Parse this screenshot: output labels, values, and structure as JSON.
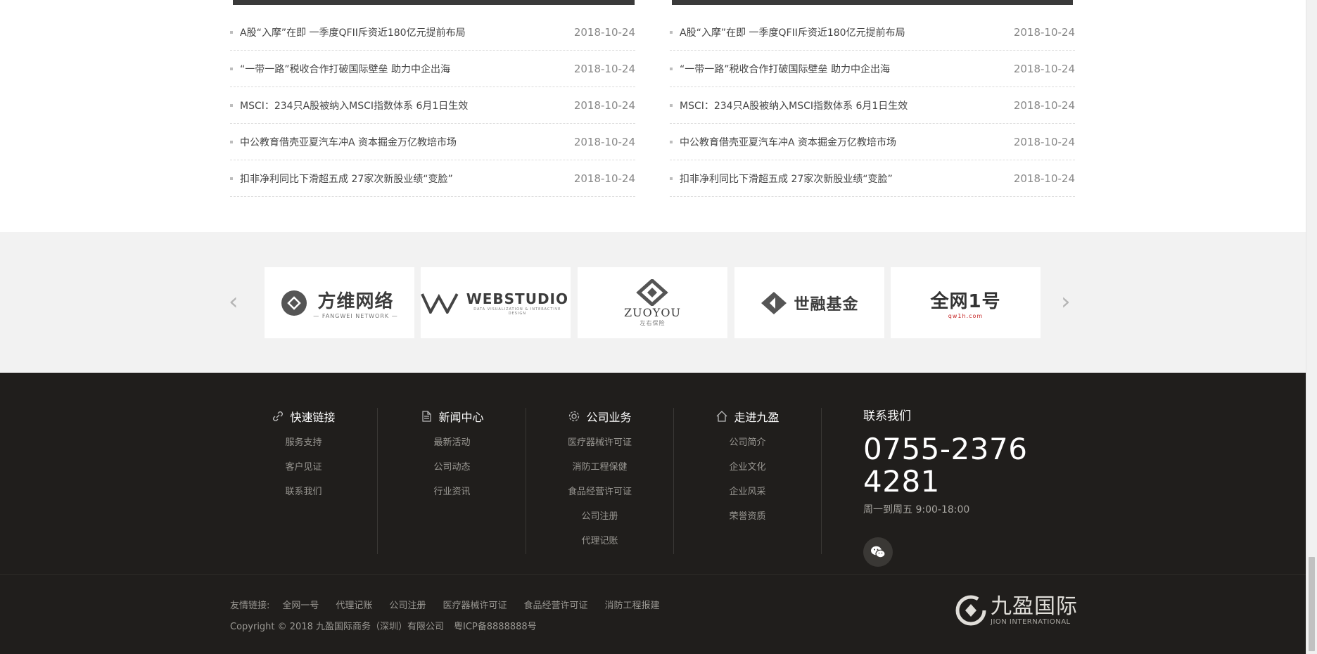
{
  "news": {
    "left_column": [
      {
        "title": "A股“入摩”在即 一季度QFII斥资近180亿元提前布局",
        "date": "2018-10-24"
      },
      {
        "title": "“一带一路”税收合作打破国际壁垒 助力中企出海",
        "date": "2018-10-24"
      },
      {
        "title": "MSCI：234只A股被纳入MSCI指数体系 6月1日生效",
        "date": "2018-10-24"
      },
      {
        "title": "中公教育借壳亚夏汽车冲A 资本掘金万亿教培市场",
        "date": "2018-10-24"
      },
      {
        "title": "扣非净利同比下滑超五成 27家次新股业绩“变脸”",
        "date": "2018-10-24"
      }
    ],
    "right_column": [
      {
        "title": "A股“入摩”在即 一季度QFII斥资近180亿元提前布局",
        "date": "2018-10-24"
      },
      {
        "title": "“一带一路”税收合作打破国际壁垒 助力中企出海",
        "date": "2018-10-24"
      },
      {
        "title": "MSCI：234只A股被纳入MSCI指数体系 6月1日生效",
        "date": "2018-10-24"
      },
      {
        "title": "中公教育借壳亚夏汽车冲A 资本掘金万亿教培市场",
        "date": "2018-10-24"
      },
      {
        "title": "扣非净利同比下滑超五成 27家次新股业绩“变脸”",
        "date": "2018-10-24"
      }
    ]
  },
  "partners": {
    "prev_icon": "chevron-left-icon",
    "next_icon": "chevron-right-icon",
    "prev_glyph": "‹",
    "next_glyph": "›",
    "logos": [
      {
        "name": "方维网络",
        "sub": "— FANGWEI NETWORK —"
      },
      {
        "name": "WEBSTUDIO",
        "sub": "DATA VISUALIZATION & INTERACTIVE DESIGN"
      },
      {
        "name": "ZUOYOU",
        "sub": "左右保险"
      },
      {
        "name": "世融基金",
        "sub": ""
      },
      {
        "name": "全网1号",
        "sub": "qw1h.com"
      }
    ]
  },
  "footer": {
    "columns": [
      {
        "title": "快速链接",
        "icon": "link-icon",
        "links": [
          "服务支持",
          "客户见证",
          "联系我们"
        ]
      },
      {
        "title": "新闻中心",
        "icon": "document-icon",
        "links": [
          "最新活动",
          "公司动态",
          "行业资讯"
        ]
      },
      {
        "title": "公司业务",
        "icon": "gear-icon",
        "links": [
          "医疗器械许可证",
          "消防工程保健",
          "食品经营许可证",
          "公司注册",
          "代理记账"
        ]
      },
      {
        "title": "走进九盈",
        "icon": "home-icon",
        "links": [
          "公司简介",
          "企业文化",
          "企业风采",
          "荣誉资质"
        ]
      }
    ],
    "contact": {
      "title": "联系我们",
      "phone": "0755-2376 4281",
      "hours": "周一到周五 9:00-18:00",
      "wechat_icon": "wechat-icon"
    },
    "friend_links": {
      "label": "友情链接:",
      "items": [
        "全网一号",
        "代理记账",
        "公司注册",
        "医疗器械许可证",
        "食品经营许可证",
        "消防工程报建"
      ]
    },
    "copyright": "Copyright © 2018 九盈国际商务（深圳）有限公司",
    "icp": "粤ICP备8888888号",
    "brand": {
      "cn": "九盈国际",
      "en": "JION INTERNATIONAL",
      "icon": "brand-logo-icon"
    }
  },
  "colors": {
    "footer_bg": "#201e1c",
    "partner_bg": "#f2f2f2",
    "text_muted": "#9a9893"
  }
}
